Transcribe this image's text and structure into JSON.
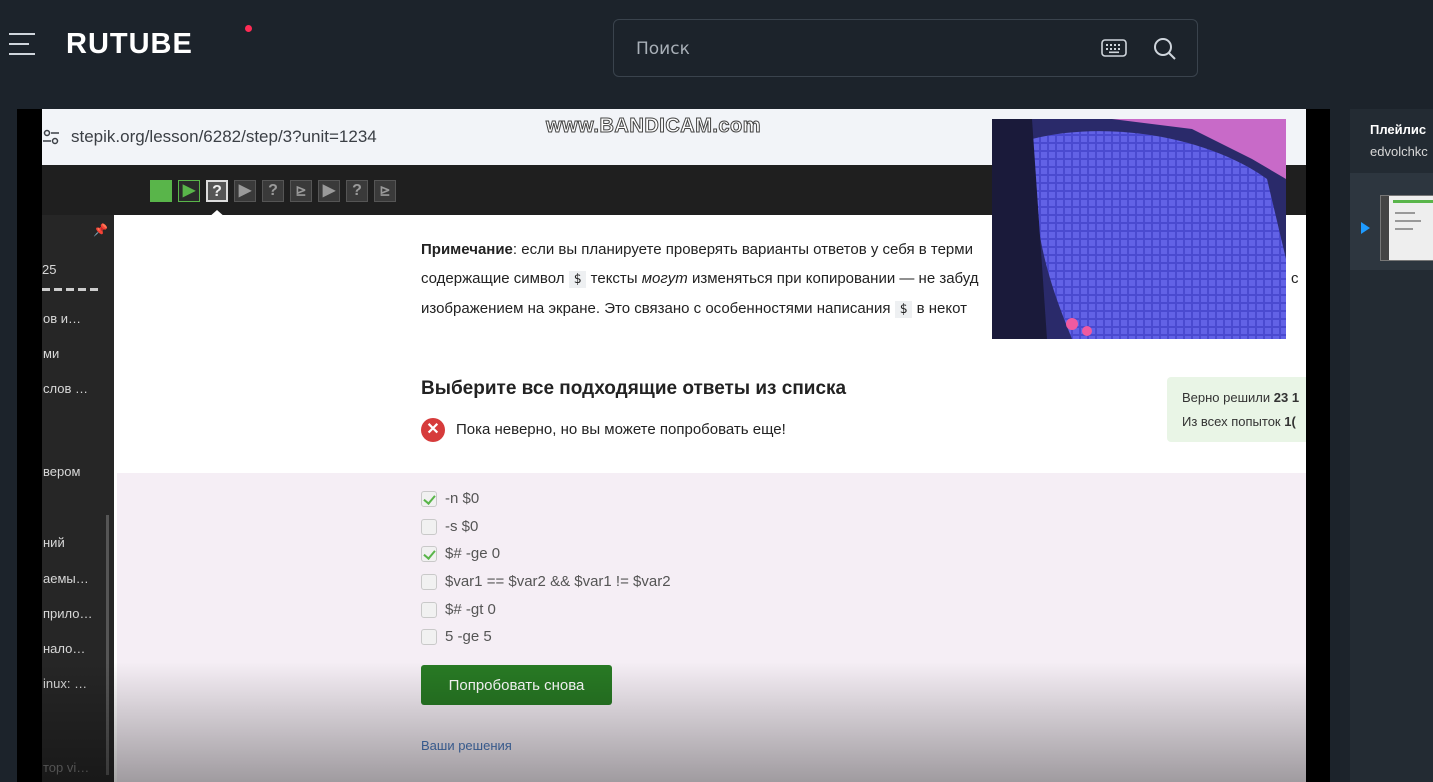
{
  "header": {
    "logo": "RUTUBE",
    "search_placeholder": "Поиск",
    "menu_icon": "hamburger-menu-icon",
    "keyboard_icon": "keyboard-icon",
    "search_icon": "search-icon"
  },
  "video": {
    "url": "stepik.org/lesson/6282/step/3?unit=1234",
    "watermark": "www.BANDICAM.com",
    "steps": [
      "done",
      "play",
      "question-active",
      "play",
      "question",
      "terminal",
      "play",
      "question",
      "terminal"
    ],
    "step_glyphs": {
      "done": "",
      "play": "▶",
      "question": "?",
      "question-active": "?",
      "terminal": "⊵"
    },
    "sidebar_items": [
      "25",
      "…ов и…",
      "…ми",
      "…слов …",
      "…вером",
      "…ний",
      "…аемы…",
      "…прило…",
      "…нало…",
      "…inux: …",
      "…тор vi…"
    ],
    "note": {
      "bold": "Примечание",
      "line1": ": если вы планируете проверять варианты ответов у себя в терми",
      "line2a": "содержащие символ ",
      "code": "$",
      "line2b": " тексты ",
      "italic": "могут",
      "line2c": " изменяться при копировании — не забуд",
      "line2d": "с",
      "line3a": "изображением на экране. Это связано с особенностями написания ",
      "line3b": " в некот"
    },
    "question_title": "Выберите все подходящие ответы из списка",
    "error_text": "Пока неверно, но вы можете попробовать еще!",
    "stats": {
      "solved_label": "Верно решили ",
      "solved_value": "23 1",
      "attempts_label": "Из всех попыток ",
      "attempts_value": "1("
    },
    "options": [
      {
        "label": "-n $0",
        "checked": true
      },
      {
        "label": "-s $0",
        "checked": false
      },
      {
        "label": "$# -ge 0",
        "checked": true
      },
      {
        "label": "$var1 == $var2 && $var1 != $var2",
        "checked": false
      },
      {
        "label": "$# -gt 0",
        "checked": false
      },
      {
        "label": "5 -ge 5",
        "checked": false
      }
    ],
    "retry_button": "Попробовать снова",
    "your_solutions": "Ваши решения"
  },
  "playlist": {
    "title": "Плейлис",
    "author": "edvolchkc"
  },
  "colors": {
    "brand_dot": "#ff2b55",
    "stepik_green": "#59b54a",
    "retry_green": "#287a24",
    "error_red": "#d63b3b",
    "play_blue": "#1e9bff"
  }
}
